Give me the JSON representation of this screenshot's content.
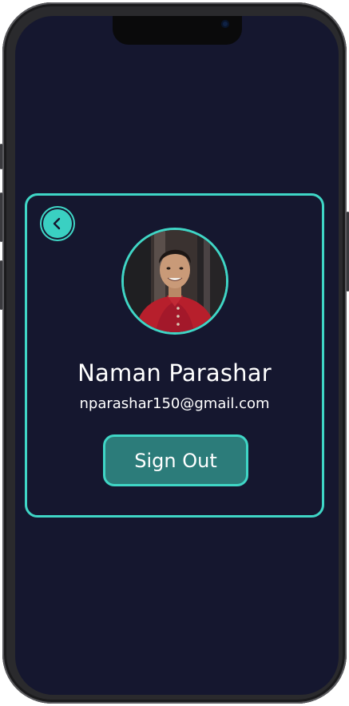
{
  "profile": {
    "name": "Naman Parashar",
    "email": "nparashar150@gmail.com",
    "avatar": "profile-photo"
  },
  "actions": {
    "sign_out_label": "Sign Out",
    "back_icon": "chevron-left-icon"
  },
  "theme": {
    "background": "#15172f",
    "accent": "#3fd6c6",
    "button_fill": "#2c7c7a",
    "text": "#ffffff"
  }
}
